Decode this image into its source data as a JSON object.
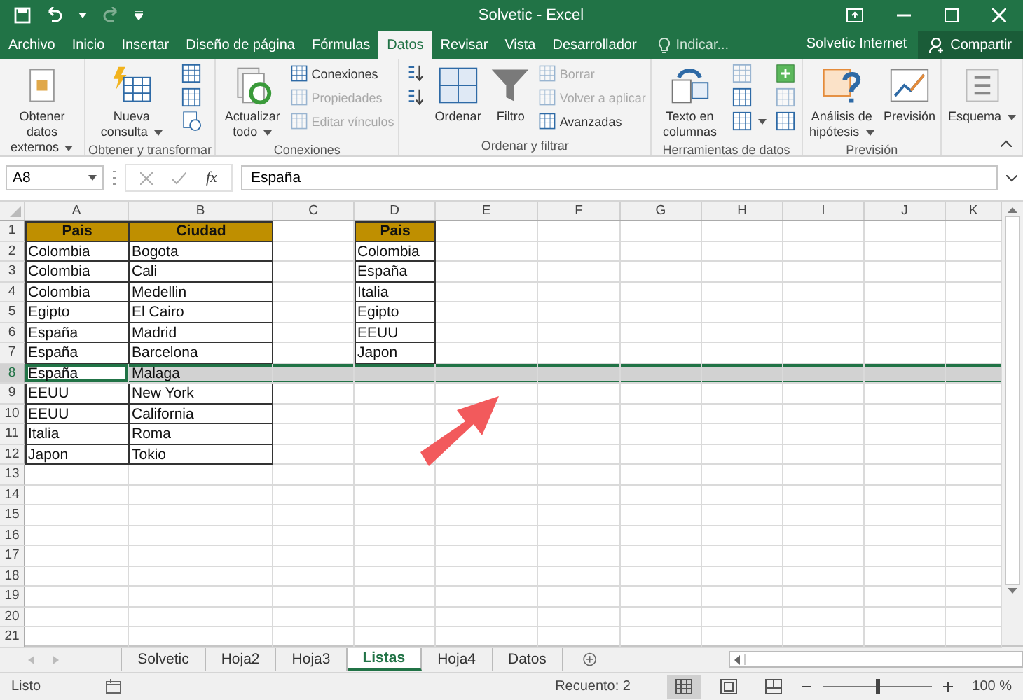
{
  "window": {
    "title": "Solvetic - Excel"
  },
  "tabs": [
    {
      "label": "Archivo",
      "selected": false
    },
    {
      "label": "Inicio",
      "selected": false
    },
    {
      "label": "Insertar",
      "selected": false
    },
    {
      "label": "Diseño de página",
      "selected": false
    },
    {
      "label": "Fórmulas",
      "selected": false
    },
    {
      "label": "Datos",
      "selected": true
    },
    {
      "label": "Revisar",
      "selected": false
    },
    {
      "label": "Vista",
      "selected": false
    },
    {
      "label": "Desarrollador",
      "selected": false
    }
  ],
  "tell_me": {
    "placeholder": "Indicar..."
  },
  "account": {
    "user": "Solvetic Internet",
    "share": "Compartir"
  },
  "ribbon": {
    "groups": [
      {
        "items": [
          {
            "kind": "large",
            "label": "Obtener datos externos",
            "dropdown": true,
            "disabled": false
          }
        ]
      },
      {
        "label": "Obtener y transformar",
        "items": [
          {
            "kind": "large",
            "label": "Nueva consulta",
            "dropdown": true,
            "disabled": false
          },
          {
            "kind": "icon",
            "dropdown": false,
            "disabled": false
          },
          {
            "kind": "icon",
            "dropdown": false,
            "disabled": false
          },
          {
            "kind": "icon",
            "dropdown": false,
            "disabled": false
          }
        ]
      },
      {
        "label": "Conexiones",
        "items": [
          {
            "kind": "large",
            "label": "Actualizar todo",
            "dropdown": true,
            "disabled": false
          },
          {
            "kind": "small",
            "label": "Conexiones",
            "dropdown": false,
            "disabled": false
          },
          {
            "kind": "small",
            "label": "Propiedades",
            "dropdown": false,
            "disabled": true
          },
          {
            "kind": "small",
            "label": "Editar vínculos",
            "dropdown": false,
            "disabled": true
          }
        ]
      },
      {
        "label": "Ordenar y filtrar",
        "items": [
          {
            "kind": "icon",
            "dropdown": false,
            "disabled": false
          },
          {
            "kind": "icon",
            "dropdown": false,
            "disabled": false
          },
          {
            "kind": "large",
            "label": "Ordenar",
            "dropdown": false,
            "disabled": false
          },
          {
            "kind": "large",
            "label": "Filtro",
            "dropdown": false,
            "disabled": false
          },
          {
            "kind": "small",
            "label": "Borrar",
            "dropdown": false,
            "disabled": true
          },
          {
            "kind": "small",
            "label": "Volver a aplicar",
            "dropdown": false,
            "disabled": true
          },
          {
            "kind": "small",
            "label": "Avanzadas",
            "dropdown": false,
            "disabled": false
          }
        ]
      },
      {
        "label": "Herramientas de datos",
        "items": [
          {
            "kind": "large",
            "label": "Texto en columnas",
            "dropdown": false,
            "disabled": false
          },
          {
            "kind": "icon",
            "dropdown": false,
            "disabled": true
          },
          {
            "kind": "icon",
            "dropdown": false,
            "disabled": false
          },
          {
            "kind": "icon",
            "dropdown": true,
            "disabled": false
          },
          {
            "kind": "icon",
            "dropdown": false,
            "disabled": false
          },
          {
            "kind": "icon",
            "dropdown": false,
            "disabled": true
          },
          {
            "kind": "icon",
            "dropdown": false,
            "disabled": false
          }
        ]
      },
      {
        "label": "Previsión",
        "items": [
          {
            "kind": "large",
            "label": "Análisis de hipótesis",
            "dropdown": true,
            "disabled": false
          },
          {
            "kind": "large",
            "label": "Previsión",
            "dropdown": false,
            "disabled": false
          }
        ]
      },
      {
        "items": [
          {
            "kind": "large",
            "label": "Esquema",
            "dropdown": true,
            "disabled": false
          }
        ]
      }
    ]
  },
  "formula_bar": {
    "name_box": "A8",
    "function_label": "fx",
    "value": "España"
  },
  "columns": [
    "A",
    "B",
    "C",
    "D",
    "E",
    "F",
    "G",
    "H",
    "I",
    "J",
    "K"
  ],
  "rows": [
    {
      "number": "1",
      "selected": false,
      "cells": [
        {
          "text": "Pais",
          "kind": "header",
          "active": false
        },
        {
          "text": "Ciudad",
          "kind": "header",
          "active": false
        },
        null,
        {
          "text": "Pais",
          "kind": "header",
          "active": false
        }
      ]
    },
    {
      "number": "2",
      "selected": false,
      "cells": [
        {
          "text": "Colombia",
          "kind": "data",
          "active": false
        },
        {
          "text": "Bogota",
          "kind": "data",
          "active": false
        },
        null,
        {
          "text": "Colombia",
          "kind": "data",
          "active": false
        }
      ]
    },
    {
      "number": "3",
      "selected": false,
      "cells": [
        {
          "text": "Colombia",
          "kind": "data",
          "active": false
        },
        {
          "text": "Cali",
          "kind": "data",
          "active": false
        },
        null,
        {
          "text": "España",
          "kind": "data",
          "active": false
        }
      ]
    },
    {
      "number": "4",
      "selected": false,
      "cells": [
        {
          "text": "Colombia",
          "kind": "data",
          "active": false
        },
        {
          "text": "Medellin",
          "kind": "data",
          "active": false
        },
        null,
        {
          "text": "Italia",
          "kind": "data",
          "active": false
        }
      ]
    },
    {
      "number": "5",
      "selected": false,
      "cells": [
        {
          "text": "Egipto",
          "kind": "data",
          "active": false
        },
        {
          "text": "El Cairo",
          "kind": "data",
          "active": false
        },
        null,
        {
          "text": "Egipto",
          "kind": "data",
          "active": false
        }
      ]
    },
    {
      "number": "6",
      "selected": false,
      "cells": [
        {
          "text": "España",
          "kind": "data",
          "active": false
        },
        {
          "text": "Madrid",
          "kind": "data",
          "active": false
        },
        null,
        {
          "text": "EEUU",
          "kind": "data",
          "active": false
        }
      ]
    },
    {
      "number": "7",
      "selected": false,
      "cells": [
        {
          "text": "España",
          "kind": "data",
          "active": false
        },
        {
          "text": "Barcelona",
          "kind": "data",
          "active": false
        },
        null,
        {
          "text": "Japon",
          "kind": "data",
          "active": false
        }
      ]
    },
    {
      "number": "8",
      "selected": true,
      "cells": [
        {
          "text": "España",
          "kind": "plain",
          "active": true
        },
        {
          "text": "Malaga",
          "kind": "plain",
          "active": false
        }
      ]
    },
    {
      "number": "9",
      "selected": false,
      "cells": [
        {
          "text": "EEUU",
          "kind": "data",
          "active": false
        },
        {
          "text": "New York",
          "kind": "data",
          "active": false
        }
      ]
    },
    {
      "number": "10",
      "selected": false,
      "cells": [
        {
          "text": "EEUU",
          "kind": "data",
          "active": false
        },
        {
          "text": "California",
          "kind": "data",
          "active": false
        }
      ]
    },
    {
      "number": "11",
      "selected": false,
      "cells": [
        {
          "text": "Italia",
          "kind": "data",
          "active": false
        },
        {
          "text": "Roma",
          "kind": "data",
          "active": false
        }
      ]
    },
    {
      "number": "12",
      "selected": false,
      "cells": [
        {
          "text": "Japon",
          "kind": "data",
          "active": false
        },
        {
          "text": "Tokio",
          "kind": "data",
          "active": false
        }
      ]
    },
    {
      "number": "13",
      "selected": false
    },
    {
      "number": "14",
      "selected": false
    },
    {
      "number": "15",
      "selected": false
    },
    {
      "number": "16",
      "selected": false
    },
    {
      "number": "17",
      "selected": false
    },
    {
      "number": "18",
      "selected": false
    },
    {
      "number": "19",
      "selected": false
    },
    {
      "number": "20",
      "selected": false
    },
    {
      "number": "21",
      "selected": false
    }
  ],
  "sheet_tabs": [
    {
      "label": "Solvetic",
      "selected": false
    },
    {
      "label": "Hoja2",
      "selected": false
    },
    {
      "label": "Hoja3",
      "selected": false
    },
    {
      "label": "Listas",
      "selected": true
    },
    {
      "label": "Hoja4",
      "selected": false
    },
    {
      "label": "Datos",
      "selected": false
    }
  ],
  "status_bar": {
    "status": "Listo",
    "summary": "Recuento: 2",
    "views": [
      {
        "selected": true
      },
      {
        "selected": false
      },
      {
        "selected": false
      }
    ],
    "zoom_slider": {
      "level": 0.5
    },
    "zoom": "100 %"
  }
}
